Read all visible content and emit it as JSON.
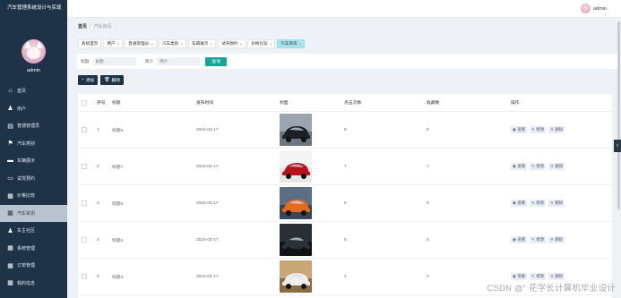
{
  "sidebar": {
    "brand": "汽车管理系统设计与实现",
    "user": "admin",
    "items": [
      {
        "label": "首页",
        "icon": "home-icon",
        "glyph": "⌂"
      },
      {
        "label": "用户",
        "icon": "user-icon",
        "glyph": "♟"
      },
      {
        "label": "普通管理员",
        "icon": "admin-icon",
        "glyph": "▤"
      },
      {
        "label": "汽车类别",
        "icon": "flag-icon",
        "glyph": "⚑"
      },
      {
        "label": "车辆展示",
        "icon": "car-icon",
        "glyph": "▬"
      },
      {
        "label": "试驾预约",
        "icon": "screen-icon",
        "glyph": "▭"
      },
      {
        "label": "价格比较",
        "icon": "grid-icon",
        "glyph": "▦"
      },
      {
        "label": "汽车资讯",
        "icon": "grid-icon",
        "glyph": "▦",
        "active": true
      },
      {
        "label": "车主社区",
        "icon": "user-icon",
        "glyph": "♟"
      },
      {
        "label": "系统管理",
        "icon": "grid-icon",
        "glyph": "▦"
      },
      {
        "label": "订单管理",
        "icon": "grid-icon",
        "glyph": "▦"
      },
      {
        "label": "我的信息",
        "icon": "grid-icon",
        "glyph": "▦"
      }
    ]
  },
  "topbar": {
    "user": "admin"
  },
  "breadcrumb": {
    "home": "首页",
    "current": "汽车资讯"
  },
  "tabs": [
    {
      "label": "系统首页",
      "closable": false
    },
    {
      "label": "用户",
      "closable": true
    },
    {
      "label": "普通管理员",
      "closable": true
    },
    {
      "label": "汽车类别",
      "closable": true
    },
    {
      "label": "车辆展示",
      "closable": true
    },
    {
      "label": "试驾预约",
      "closable": true
    },
    {
      "label": "价格比较",
      "closable": true
    },
    {
      "label": "汽车资讯",
      "closable": true,
      "active": true
    }
  ],
  "search": {
    "title_label": "标题",
    "title_placeholder": "标题",
    "summary_label": "简介",
    "summary_placeholder": "简介",
    "button": "查询"
  },
  "actions": {
    "add": "添加",
    "delete": "删除"
  },
  "table": {
    "headers": [
      "序号",
      "标题",
      "发布时间",
      "封面",
      "点击次数",
      "收藏数",
      "操作"
    ],
    "rows": [
      {
        "no": "1",
        "title": "标题8",
        "date": "2024-02-17",
        "clicks": "8",
        "favs": "8",
        "cover": "dark-suv"
      },
      {
        "no": "2",
        "title": "标题7",
        "date": "2024-02-17",
        "clicks": "7",
        "favs": "7",
        "cover": "red-coupe"
      },
      {
        "no": "3",
        "title": "标题6",
        "date": "2024-02-17",
        "clicks": "6",
        "favs": "6",
        "cover": "orange-sedan"
      },
      {
        "no": "4",
        "title": "标题5",
        "date": "2024-02-17",
        "clicks": "5",
        "favs": "5",
        "cover": "dark-sedan"
      },
      {
        "no": "5",
        "title": "标题4",
        "date": "2024-02-17",
        "clicks": "4",
        "favs": "4",
        "cover": "white-coupe"
      }
    ],
    "ops": {
      "view": "查看",
      "edit": "修改",
      "delete": "删除"
    }
  },
  "watermark": "CSDN @“ 花学长计算机毕业设计",
  "colors": {
    "sidebar": "#1e3348",
    "accent": "#17a59b",
    "active_tab": "#a9e6f0"
  }
}
